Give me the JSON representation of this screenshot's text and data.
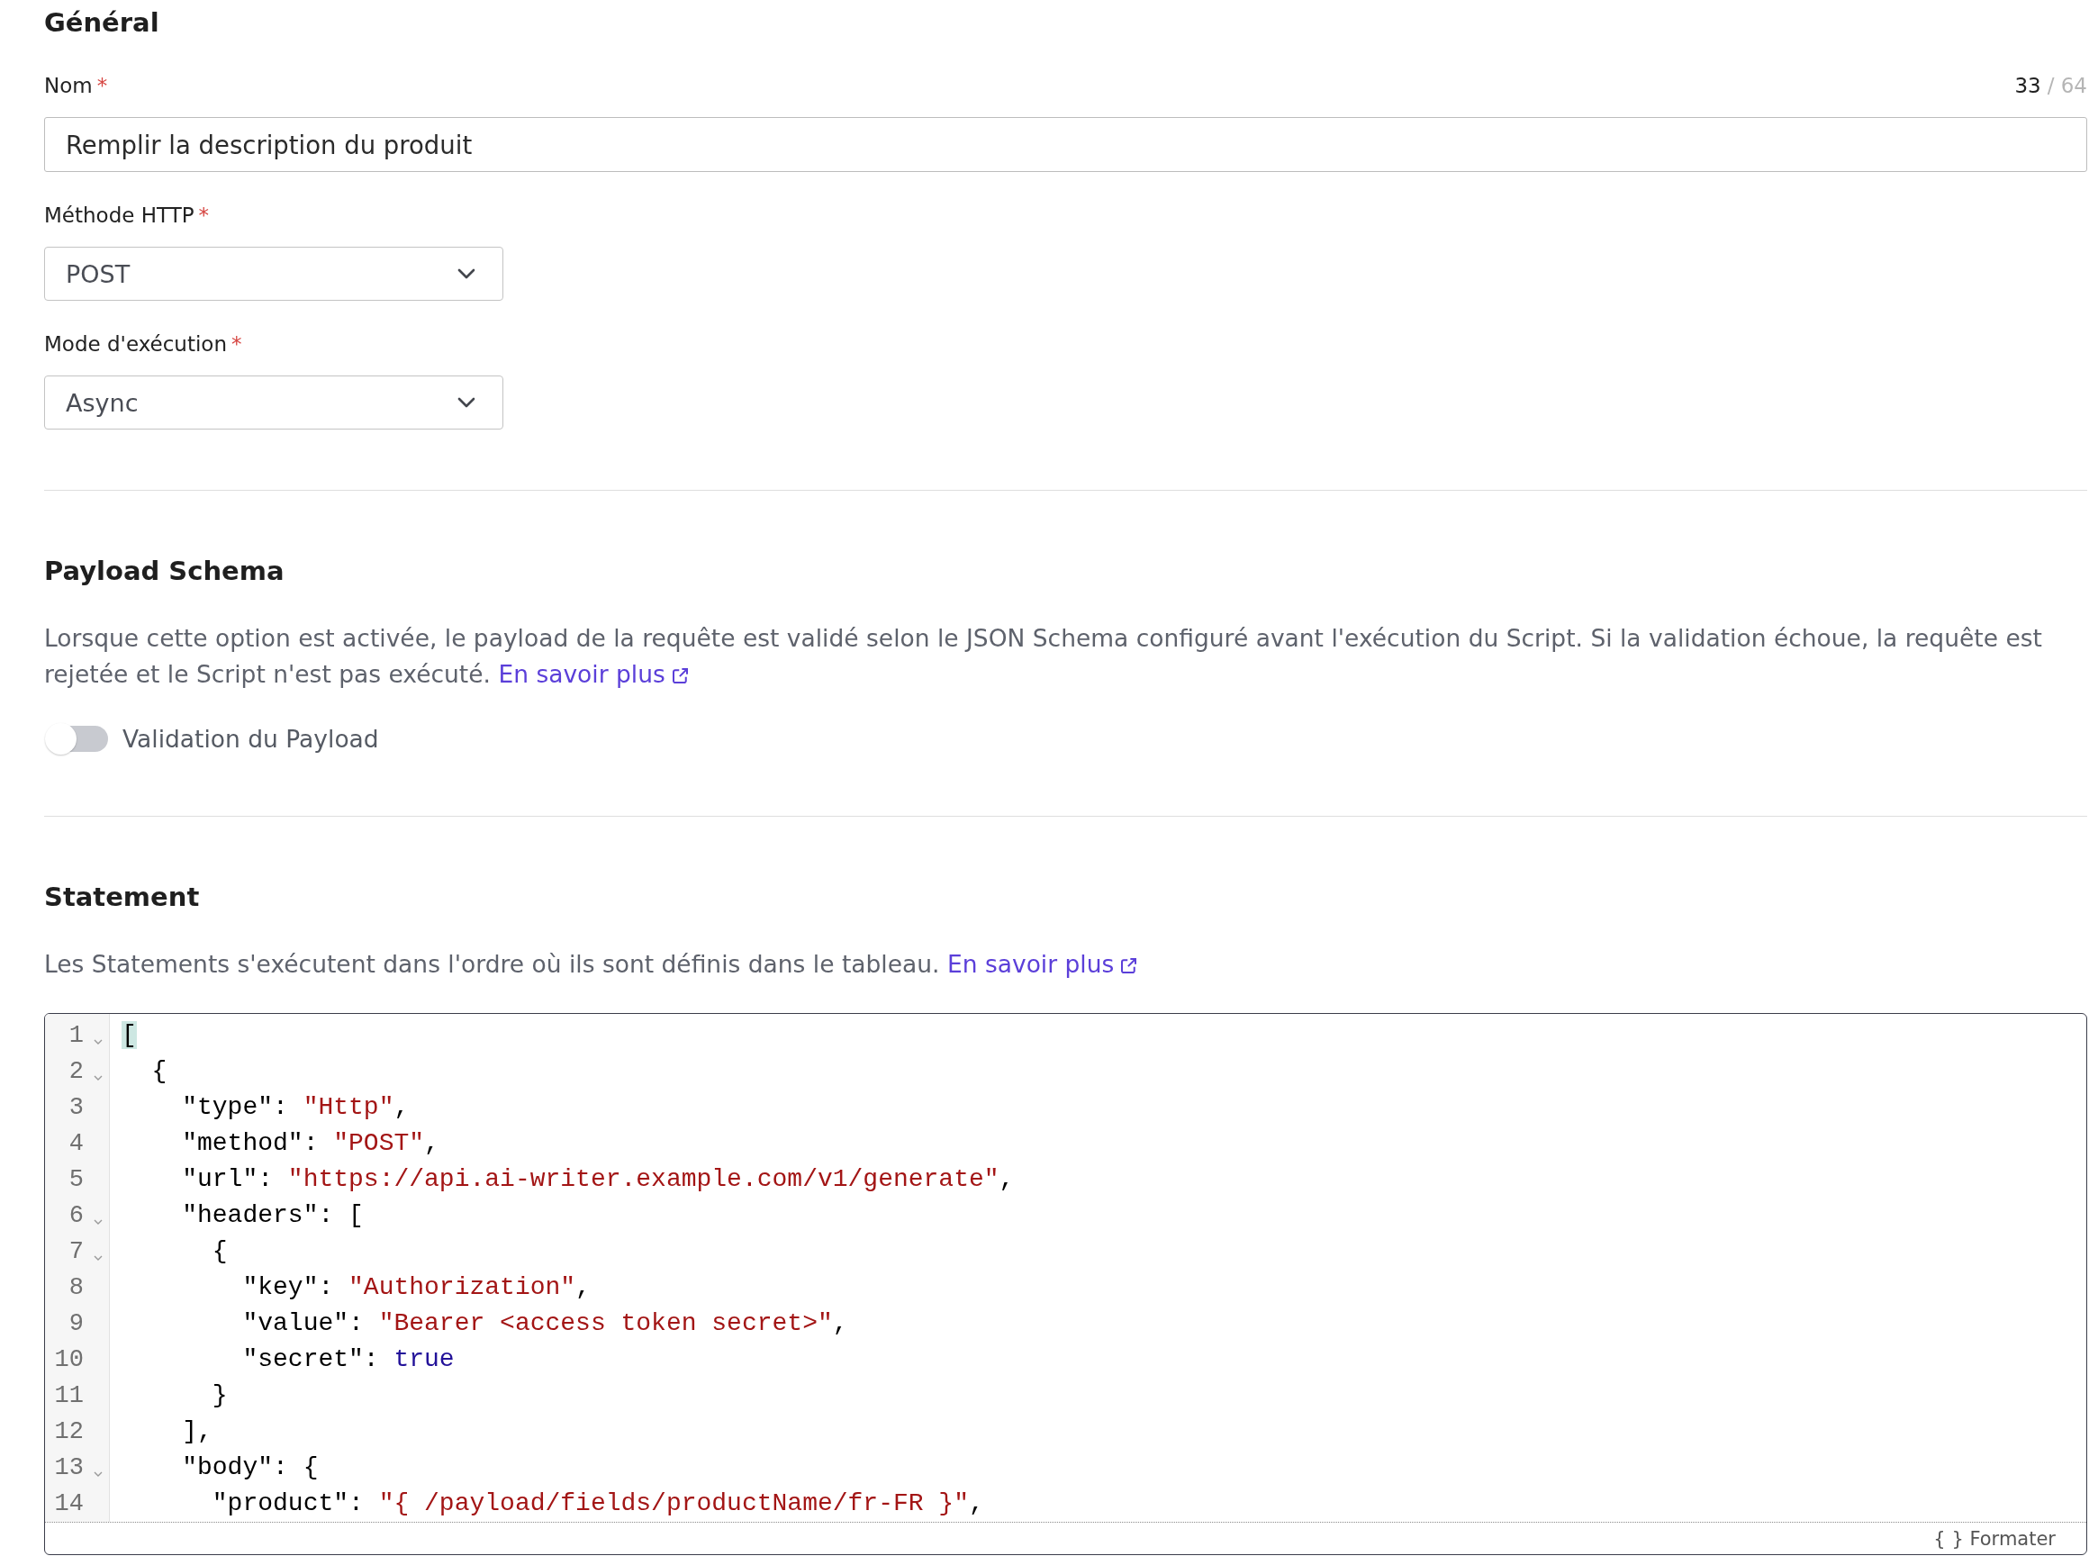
{
  "general": {
    "title": "Général",
    "fields": [
      {
        "kind": "text",
        "label": "Nom",
        "required_mark": "*",
        "value": "Remplir la description du produit",
        "count": "33",
        "limit": "/ 64"
      },
      {
        "kind": "select",
        "label": "Méthode HTTP",
        "required_mark": "*",
        "value": "POST"
      },
      {
        "kind": "select",
        "label": "Mode d'exécution",
        "required_mark": "*",
        "value": "Async"
      }
    ]
  },
  "payload_schema": {
    "title": "Payload Schema",
    "description": "Lorsque cette option est activée, le payload de la requête est validé selon le JSON Schema configuré avant l'exécution du Script. Si la validation échoue, la requête est rejetée et le Script n'est pas exécuté.",
    "link": "En savoir plus",
    "toggle": {
      "label": "Validation du Payload",
      "on": false
    }
  },
  "statement": {
    "title": "Statement",
    "description": "Les Statements s'exécutent dans l'ordre où ils sont définis dans le tableau.",
    "link": "En savoir plus",
    "editor": {
      "lines": [
        {
          "number": "1",
          "foldable": true,
          "tokens": [
            {
              "kind": "matched",
              "text": "["
            }
          ]
        },
        {
          "number": "2",
          "foldable": true,
          "tokens": [
            {
              "kind": "plain",
              "text": "  {"
            }
          ]
        },
        {
          "number": "3",
          "foldable": false,
          "tokens": [
            {
              "kind": "plain",
              "text": "    \"type\": "
            },
            {
              "kind": "string",
              "text": "\"Http\""
            },
            {
              "kind": "plain",
              "text": ","
            }
          ]
        },
        {
          "number": "4",
          "foldable": false,
          "tokens": [
            {
              "kind": "plain",
              "text": "    \"method\": "
            },
            {
              "kind": "string",
              "text": "\"POST\""
            },
            {
              "kind": "plain",
              "text": ","
            }
          ]
        },
        {
          "number": "5",
          "foldable": false,
          "tokens": [
            {
              "kind": "plain",
              "text": "    \"url\": "
            },
            {
              "kind": "string",
              "text": "\"https://api.ai-writer.example.com/v1/generate\""
            },
            {
              "kind": "plain",
              "text": ","
            }
          ]
        },
        {
          "number": "6",
          "foldable": true,
          "tokens": [
            {
              "kind": "plain",
              "text": "    \"headers\": ["
            }
          ]
        },
        {
          "number": "7",
          "foldable": true,
          "tokens": [
            {
              "kind": "plain",
              "text": "      {"
            }
          ]
        },
        {
          "number": "8",
          "foldable": false,
          "tokens": [
            {
              "kind": "plain",
              "text": "        \"key\": "
            },
            {
              "kind": "string",
              "text": "\"Authorization\""
            },
            {
              "kind": "plain",
              "text": ","
            }
          ]
        },
        {
          "number": "9",
          "foldable": false,
          "tokens": [
            {
              "kind": "plain",
              "text": "        \"value\": "
            },
            {
              "kind": "string",
              "text": "\"Bearer <access token secret>\""
            },
            {
              "kind": "plain",
              "text": ","
            }
          ]
        },
        {
          "number": "10",
          "foldable": false,
          "tokens": [
            {
              "kind": "plain",
              "text": "        \"secret\": "
            },
            {
              "kind": "atom",
              "text": "true"
            }
          ]
        },
        {
          "number": "11",
          "foldable": false,
          "tokens": [
            {
              "kind": "plain",
              "text": "      }"
            }
          ]
        },
        {
          "number": "12",
          "foldable": false,
          "tokens": [
            {
              "kind": "plain",
              "text": "    ],"
            }
          ]
        },
        {
          "number": "13",
          "foldable": true,
          "tokens": [
            {
              "kind": "plain",
              "text": "    \"body\": {"
            }
          ]
        },
        {
          "number": "14",
          "foldable": false,
          "tokens": [
            {
              "kind": "plain",
              "text": "      \"product\": "
            },
            {
              "kind": "string",
              "text": "\"{ /payload/fields/productName/fr-FR }\""
            },
            {
              "kind": "plain",
              "text": ","
            }
          ]
        }
      ],
      "format_button": "{ } Formater"
    }
  }
}
